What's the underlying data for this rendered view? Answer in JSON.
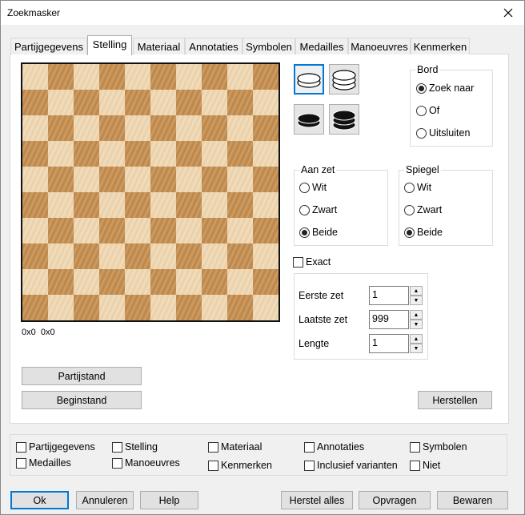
{
  "window": {
    "title": "Zoekmasker"
  },
  "tabs": [
    "Partijgegevens",
    "Stelling",
    "Materiaal",
    "Annotaties",
    "Symbolen",
    "Medailles",
    "Manoeuvres",
    "Kenmerken"
  ],
  "board": {
    "coords": "0x0  0x0"
  },
  "pieces": {
    "selected": "white-man"
  },
  "bord": {
    "title": "Bord",
    "options": [
      "Zoek naar",
      "Of",
      "Uitsluiten"
    ],
    "selected": 0
  },
  "aan_zet": {
    "title": "Aan zet",
    "options": [
      "Wit",
      "Zwart",
      "Beide"
    ],
    "selected": 2
  },
  "spiegel": {
    "title": "Spiegel",
    "options": [
      "Wit",
      "Zwart",
      "Beide"
    ],
    "selected": 2
  },
  "exact_label": "Exact",
  "spinners": [
    {
      "label": "Eerste zet",
      "value": "1"
    },
    {
      "label": "Laatste zet",
      "value": "999"
    },
    {
      "label": "Lengte",
      "value": "1"
    }
  ],
  "buttons": {
    "partijstand": "Partijstand",
    "beginstand": "Beginstand",
    "herstellen": "Herstellen",
    "ok": "Ok",
    "annuleren": "Annuleren",
    "help": "Help",
    "herstel_alles": "Herstel alles",
    "opvragen": "Opvragen",
    "bewaren": "Bewaren"
  },
  "filters": {
    "row1": [
      "Partijgegevens",
      "Stelling",
      "Materiaal",
      "Annotaties",
      "Symbolen"
    ],
    "row2": [
      "Medailles",
      "Manoeuvres",
      "Kenmerken",
      "Inclusief varianten",
      "Niet"
    ]
  }
}
